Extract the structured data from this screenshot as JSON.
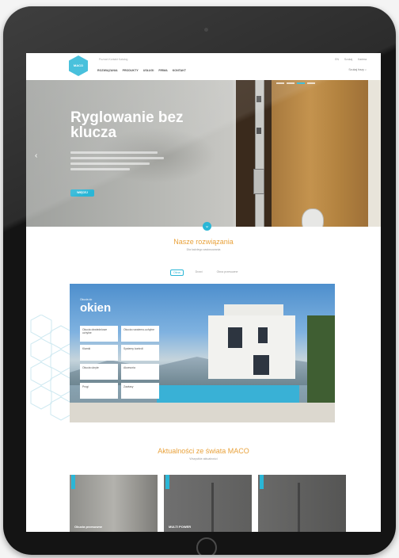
{
  "header": {
    "logo_text": "MACO",
    "top_links": "Poznań   Kontakt   Katalog",
    "top_right": [
      "EN",
      "Szukaj",
      "Kariera"
    ],
    "nav": [
      "ROZWIĄZANIA",
      "PRODUKTY",
      "USŁUGI",
      "FIRMA",
      "KONTAKT"
    ],
    "search_label": "Szukaj frazy"
  },
  "hero": {
    "title": "Ryglowanie bez klucza",
    "button_label": "WIĘCEJ",
    "prev_arrow": "‹"
  },
  "solutions": {
    "title": "Nasze rozwiązania",
    "subtitle": "Dla każdego zastosowania",
    "tabs": [
      "Okna",
      "Drzwi",
      "Okna przesuwne"
    ],
    "active_tab": 0
  },
  "feature": {
    "small_label": "Okucia do",
    "title": "okien",
    "items": [
      "Okucia obwiedniowe uchylne",
      "Okucia rozwierno-uchylne",
      "Klamki",
      "Systemy kontroli",
      "Okucia ukryte",
      "Akcesoria",
      "Progi",
      "Zawiasy"
    ]
  },
  "news": {
    "title": "Aktualności ze świata MACO",
    "subtitle": "Wszystkie aktualności",
    "cards": [
      {
        "label": "Okucia przesuwne"
      },
      {
        "label": "MULTI POWER"
      },
      {
        "label": ""
      }
    ]
  },
  "colors": {
    "accent": "#2ab6d6",
    "headline": "#e9a23b"
  }
}
